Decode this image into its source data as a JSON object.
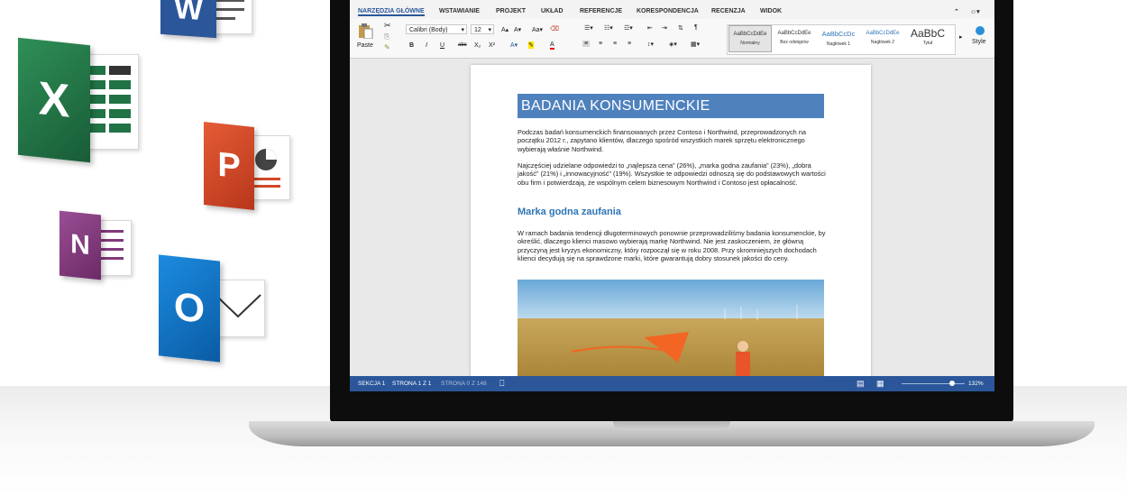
{
  "app_icons": [
    {
      "name": "word",
      "letter": "W",
      "color": "#2b579a"
    },
    {
      "name": "excel",
      "letter": "X",
      "color": "#217346"
    },
    {
      "name": "powerpoint",
      "letter": "P",
      "color": "#d24726"
    },
    {
      "name": "onenote",
      "letter": "N",
      "color": "#80397b"
    },
    {
      "name": "outlook",
      "letter": "O",
      "color": "#0072c6"
    }
  ],
  "ribbon": {
    "tabs": [
      "NARZĘDZIA GŁÓWNE",
      "WSTAWIANIE",
      "PROJEKT",
      "UKŁAD",
      "REFERENCJE",
      "KORESPONDENCJA",
      "RECENZJA",
      "WIDOK"
    ],
    "active_tab": 0,
    "paste_label": "Paste",
    "font_name": "Calibri (Body)",
    "font_size": "12",
    "format_buttons": [
      "B",
      "I",
      "U",
      "abc",
      "X₂",
      "X²"
    ],
    "styles": [
      {
        "sample": "AaBbCcDdEe",
        "name": "Normalny"
      },
      {
        "sample": "AaBbCcDdEe",
        "name": "Bez odstępów"
      },
      {
        "sample": "AaBbCcDc",
        "name": "Nagłówek 1"
      },
      {
        "sample": "AaBbCcDdEe",
        "name": "Nagłówek 2"
      },
      {
        "sample": "AaBbC",
        "name": "Tytuł"
      }
    ],
    "styles_pane_label": "Style"
  },
  "document": {
    "title": "BADANIA KONSUMENCKIE",
    "para1": "Podczas badań konsumenckich finansowanych przez Contoso i Northwind, przeprowadzonych na początku 2012 r., zapytano klientów, dlaczego spośród wszystkich marek sprzętu elektronicznego wybierają właśnie Northwind.",
    "para2": "Najczęściej udzielane odpowiedzi to „najlepsza cena” (26%), „marka godna zaufania” (23%), „dobra jakość” (21%) i „innowacyjność” (19%). Wszystkie te odpowiedzi odnoszą się do podstawowych wartości obu firm i potwierdzają, że wspólnym celem biznesowym Northwind i Contoso jest opłacalność.",
    "heading2": "Marka godna zaufania",
    "para3": "W ramach badania tendencji długoterminowych ponownie przeprowadziliśmy badania konsumenckie, by określić, dlaczego klienci masowo wybierają markę Northwind. Nie jest zaskoczeniem, że główną przyczyną jest kryzys ekonomiczny, który rozpoczął się w roku 2008. Przy skromniejszych dochodach klienci decydują się na sprawdzone marki, które gwarantują dobry stosunek jakości do ceny."
  },
  "status_bar": {
    "section": "SEKCJA 1",
    "page": "STRONA 1 Z 1",
    "page_dim": "STRONA 0 Z 148",
    "zoom": "132%",
    "zoom_fraction": 0.8,
    "color": "#2b579a"
  }
}
